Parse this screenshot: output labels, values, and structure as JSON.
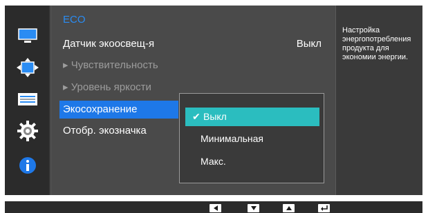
{
  "panel": {
    "title": "ECO",
    "items": [
      {
        "label": "Датчик экоосвещ-я",
        "value": "Выкл",
        "enabled": true
      },
      {
        "label": "▸ Чувствительность",
        "enabled": false
      },
      {
        "label": "▸ Уровень яркости",
        "enabled": false
      },
      {
        "label": "Экосохранение",
        "selected": true
      },
      {
        "label": "Отобр. экозначка",
        "enabled": true
      }
    ]
  },
  "dropdown": {
    "options": [
      {
        "label": "Выкл",
        "checked": true
      },
      {
        "label": "Минимальная",
        "checked": false
      },
      {
        "label": "Макс.",
        "checked": false
      }
    ]
  },
  "help_text": "Настройка энергопотребления продукта для экономии энергии.",
  "sidebar_icons": [
    "monitor-icon",
    "position-arrows-icon",
    "menu-list-icon",
    "gear-icon",
    "info-icon"
  ],
  "controls": [
    "left-arrow-key",
    "down-arrow-key",
    "up-arrow-key",
    "enter-key"
  ],
  "colors": {
    "accent_blue": "#1e78e8",
    "title_blue": "#2a8cf3",
    "dropdown_highlight": "#2bbdbf",
    "panel": "#4a4a4a",
    "background": "#3a3a3a"
  }
}
